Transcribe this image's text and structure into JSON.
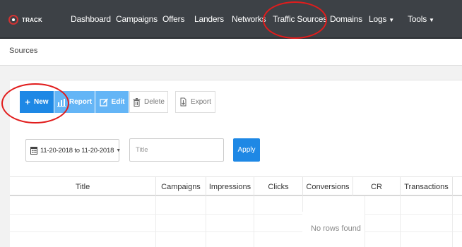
{
  "brand": {
    "logo_part1": "",
    "logo_part2": "TRACK"
  },
  "nav": {
    "items": [
      {
        "label": "Dashboard"
      },
      {
        "label": "Campaigns"
      },
      {
        "label": "Offers"
      },
      {
        "label": "Landers"
      },
      {
        "label": "Networks"
      },
      {
        "label": "Traffic Sources",
        "active": true
      },
      {
        "label": "Domains"
      },
      {
        "label": "Logs"
      },
      {
        "label": "Tools"
      }
    ]
  },
  "breadcrumb": "Sources",
  "toolbar": {
    "new_label": "New",
    "report_label": "Report",
    "edit_label": "Edit",
    "delete_label": "Delete",
    "export_label": "Export"
  },
  "filters": {
    "date_range": "11-20-2018 to 11-20-2018",
    "title_placeholder": "Title",
    "apply_label": "Apply"
  },
  "table": {
    "columns": [
      "Title",
      "Campaigns",
      "Impressions",
      "Clicks",
      "Conversions",
      "CR",
      "Transactions"
    ],
    "empty_message": "No rows found"
  },
  "colors": {
    "navbar": "#3d4146",
    "primary": "#1e88e5",
    "primary_light": "#64b5f6",
    "annotation": "#e11c1c"
  }
}
